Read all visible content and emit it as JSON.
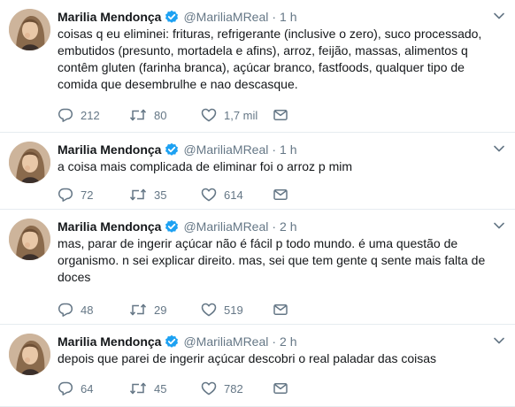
{
  "tweets": [
    {
      "name": "Marilia Mendonça",
      "handle": "@MariliaMReal",
      "separator": "·",
      "time": "1 h",
      "text": "coisas q eu eliminei: frituras, refrigerante (inclusive o zero), suco processado, embutidos (presunto, mortadela e afins), arroz, feijão, massas, alimentos q contêm gluten (farinha branca), açúcar branco, fastfoods, qualquer tipo de comida que desembrulhe e nao descasque.",
      "replies": "212",
      "retweets": "80",
      "likes": "1,7 mil"
    },
    {
      "name": "Marilia Mendonça",
      "handle": "@MariliaMReal",
      "separator": "·",
      "time": "1 h",
      "text": "a coisa mais complicada de eliminar foi o arroz p mim",
      "replies": "72",
      "retweets": "35",
      "likes": "614"
    },
    {
      "name": "Marilia Mendonça",
      "handle": "@MariliaMReal",
      "separator": "·",
      "time": "2 h",
      "text": "mas, parar de ingerir açúcar não é fácil p todo mundo. é uma questão de organismo. n sei explicar direito. mas, sei que tem gente q sente mais falta de doces",
      "replies": "48",
      "retweets": "29",
      "likes": "519"
    },
    {
      "name": "Marilia Mendonça",
      "handle": "@MariliaMReal",
      "separator": "·",
      "time": "2 h",
      "text": "depois que parei de ingerir açúcar descobri o real paladar das coisas",
      "replies": "64",
      "retweets": "45",
      "likes": "782"
    }
  ],
  "colors": {
    "text": "#14171a",
    "muted": "#657786",
    "verified": "#1da1f2",
    "divider": "#e6ecf0"
  },
  "icons": [
    "reply-icon",
    "retweet-icon",
    "like-icon",
    "direct-message-icon",
    "verified-badge-icon",
    "chevron-down-icon"
  ]
}
